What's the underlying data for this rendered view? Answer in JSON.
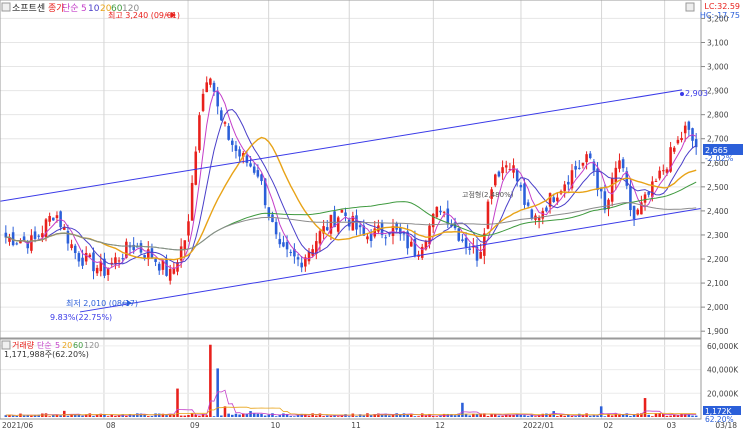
{
  "price_legend": {
    "stock_name": "소프트센",
    "price_label": "종가",
    "ma_label": "단순",
    "periods": [
      "5",
      "10",
      "20",
      "60",
      "120"
    ]
  },
  "volume_legend": {
    "label": "거래량",
    "ma_label": "단순",
    "periods": [
      "5",
      "20",
      "60",
      "120"
    ],
    "volume_text": "1,171,988주(62.20%)"
  },
  "top_right": {
    "lc_text": "LC:32.59",
    "hc_text": "HC:-17.75"
  },
  "annotations": {
    "high_text": "최고 3,240 (09/01)",
    "low_text": "최저 2,010 (08/17)",
    "ratio_text": "9.83%(22.75%)",
    "channel_value_text": "2,903",
    "mid_text": "고점형(2,480%)"
  },
  "price_axis": {
    "ticks": [
      "3,200",
      "3,100",
      "3,000",
      "2,900",
      "2,800",
      "2,700",
      "2,600",
      "2,500",
      "2,400",
      "2,300",
      "2,200",
      "2,100",
      "2,000",
      "1,900"
    ],
    "current_price_label": "2,665",
    "current_change_label": "-2.02%"
  },
  "volume_axis": {
    "ticks": [
      "60,000K",
      "40,000K",
      "20,000K"
    ],
    "current_volume_label": "1,172K",
    "current_ratio_label": "62.20%"
  },
  "date_axis": {
    "labels": [
      "2021/06",
      "08",
      "09",
      "10",
      "11",
      "12",
      "2022/01",
      "02",
      "03",
      "03/18"
    ]
  },
  "colors": {
    "up": "#e8201c",
    "down": "#2b5fd9",
    "ma5": "#c43fc9",
    "ma10": "#4a3fc9",
    "ma20": "#e8a317",
    "ma60": "#3f9a3f",
    "ma120": "#8c8c8c",
    "channel": "#3a3ae8"
  },
  "chart_data": {
    "type": "candlestick",
    "y_range": [
      1880,
      3260
    ],
    "volume_range_k": [
      0,
      65000
    ],
    "n_bars": 190,
    "highest": {
      "value": 3240,
      "date": "09/01"
    },
    "lowest": {
      "value": 2010,
      "date": "08/17"
    },
    "last_price": 2665,
    "last_change_pct": -2.02,
    "last_volume": 1171988,
    "channel": {
      "upper_start": 2440,
      "upper_end": 2903,
      "lower_start": 1980,
      "lower_end": 2410
    },
    "anchors": [
      [
        0,
        2290
      ],
      [
        8,
        2270
      ],
      [
        14,
        2400
      ],
      [
        20,
        2220
      ],
      [
        28,
        2150
      ],
      [
        36,
        2260
      ],
      [
        42,
        2210
      ],
      [
        47,
        2130
      ],
      [
        52,
        2320
      ],
      [
        55,
        2800
      ],
      [
        58,
        3010
      ],
      [
        61,
        2780
      ],
      [
        66,
        2640
      ],
      [
        72,
        2560
      ],
      [
        78,
        2230
      ],
      [
        84,
        2190
      ],
      [
        90,
        2310
      ],
      [
        96,
        2400
      ],
      [
        102,
        2290
      ],
      [
        110,
        2330
      ],
      [
        117,
        2230
      ],
      [
        124,
        2420
      ],
      [
        130,
        2290
      ],
      [
        135,
        2210
      ],
      [
        139,
        2550
      ],
      [
        144,
        2610
      ],
      [
        150,
        2350
      ],
      [
        156,
        2460
      ],
      [
        162,
        2570
      ],
      [
        167,
        2620
      ],
      [
        171,
        2390
      ],
      [
        175,
        2620
      ],
      [
        179,
        2360
      ],
      [
        185,
        2500
      ],
      [
        190,
        2640
      ],
      [
        194,
        2740
      ],
      [
        197,
        2665
      ]
    ],
    "volume_spikes_k": [
      [
        17,
        5200
      ],
      [
        49,
        24000
      ],
      [
        58,
        61000
      ],
      [
        60,
        41000
      ],
      [
        63,
        9000
      ],
      [
        70,
        5000
      ],
      [
        130,
        12000
      ],
      [
        156,
        5000
      ],
      [
        170,
        9000
      ],
      [
        182,
        16000
      ]
    ]
  }
}
